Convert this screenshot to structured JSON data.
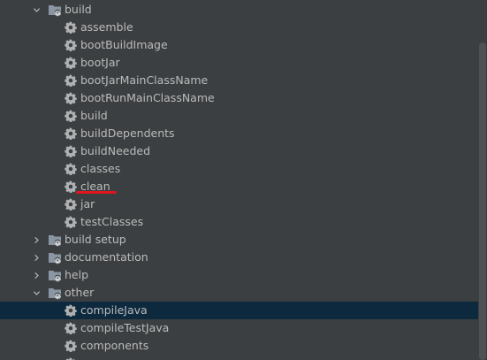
{
  "tree": {
    "items": [
      {
        "label": "build",
        "type": "folder",
        "expanded": true,
        "icon": "gradle-folder-icon"
      },
      {
        "label": "assemble",
        "type": "task",
        "icon": "gear-icon"
      },
      {
        "label": "bootBuildImage",
        "type": "task",
        "icon": "gear-icon"
      },
      {
        "label": "bootJar",
        "type": "task",
        "icon": "gear-icon"
      },
      {
        "label": "bootJarMainClassName",
        "type": "task",
        "icon": "gear-icon"
      },
      {
        "label": "bootRunMainClassName",
        "type": "task",
        "icon": "gear-icon"
      },
      {
        "label": "build",
        "type": "task",
        "icon": "gear-icon"
      },
      {
        "label": "buildDependents",
        "type": "task",
        "icon": "gear-icon"
      },
      {
        "label": "buildNeeded",
        "type": "task",
        "icon": "gear-icon"
      },
      {
        "label": "classes",
        "type": "task",
        "icon": "gear-icon"
      },
      {
        "label": "clean",
        "type": "task",
        "icon": "gear-icon",
        "annotated": true
      },
      {
        "label": "jar",
        "type": "task",
        "icon": "gear-icon"
      },
      {
        "label": "testClasses",
        "type": "task",
        "icon": "gear-icon"
      },
      {
        "label": "build setup",
        "type": "folder",
        "expanded": false,
        "icon": "gradle-folder-icon"
      },
      {
        "label": "documentation",
        "type": "folder",
        "expanded": false,
        "icon": "gradle-folder-icon"
      },
      {
        "label": "help",
        "type": "folder",
        "expanded": false,
        "icon": "gradle-folder-icon"
      },
      {
        "label": "other",
        "type": "folder",
        "expanded": true,
        "icon": "gradle-folder-icon"
      },
      {
        "label": "compileJava",
        "type": "task",
        "icon": "gear-icon",
        "selected": true
      },
      {
        "label": "compileTestJava",
        "type": "task",
        "icon": "gear-icon"
      },
      {
        "label": "components",
        "type": "task",
        "icon": "gear-icon"
      },
      {
        "label": "",
        "type": "task",
        "icon": "gear-icon"
      }
    ]
  },
  "colors": {
    "background": "#3c3f41",
    "text": "#bbbbbb",
    "selection": "#0d293e",
    "annotation": "#e0151e",
    "folder": "#8b96a5",
    "gear": "#afb1b3"
  }
}
